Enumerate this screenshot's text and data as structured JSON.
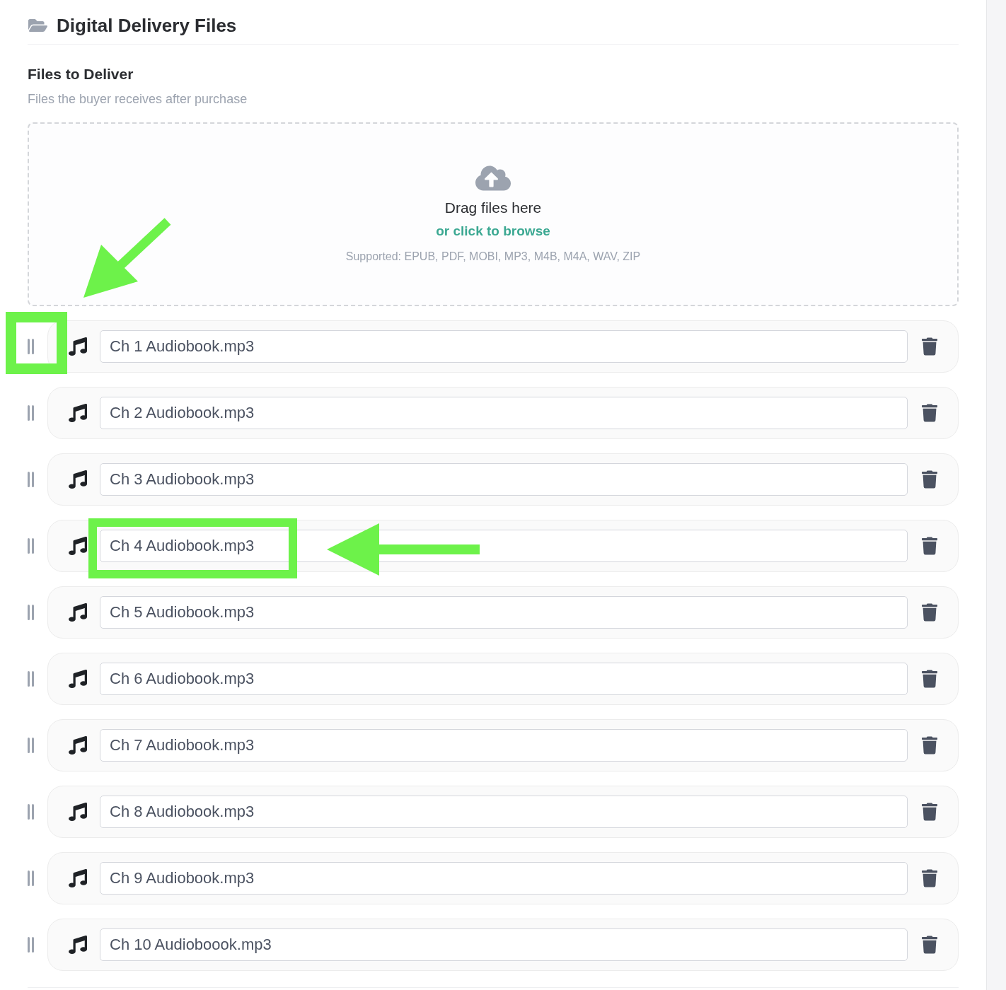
{
  "header": {
    "title": "Digital Delivery Files"
  },
  "section": {
    "title": "Files to Deliver",
    "subtitle": "Files the buyer receives after purchase"
  },
  "dropzone": {
    "title": "Drag files here",
    "link": "or click to browse",
    "supported": "Supported: EPUB, PDF, MOBI, MP3, M4B, M4A, WAV, ZIP"
  },
  "files": [
    {
      "name": "Ch 1 Audiobook.mp3",
      "handle_marked": true,
      "name_marked": false
    },
    {
      "name": "Ch 2 Audiobook.mp3",
      "handle_marked": false,
      "name_marked": false
    },
    {
      "name": "Ch 3 Audiobook.mp3",
      "handle_marked": false,
      "name_marked": false
    },
    {
      "name": "Ch 4 Audiobook.mp3",
      "handle_marked": false,
      "name_marked": true
    },
    {
      "name": "Ch 5 Audiobook.mp3",
      "handle_marked": false,
      "name_marked": false
    },
    {
      "name": "Ch 6 Audiobook.mp3",
      "handle_marked": false,
      "name_marked": false
    },
    {
      "name": "Ch 7 Audiobook.mp3",
      "handle_marked": false,
      "name_marked": false
    },
    {
      "name": "Ch 8 Audiobook.mp3",
      "handle_marked": false,
      "name_marked": false
    },
    {
      "name": "Ch 9 Audiobook.mp3",
      "handle_marked": false,
      "name_marked": false
    },
    {
      "name": "Ch 10 Audioboook.mp3",
      "handle_marked": false,
      "name_marked": false
    }
  ]
}
